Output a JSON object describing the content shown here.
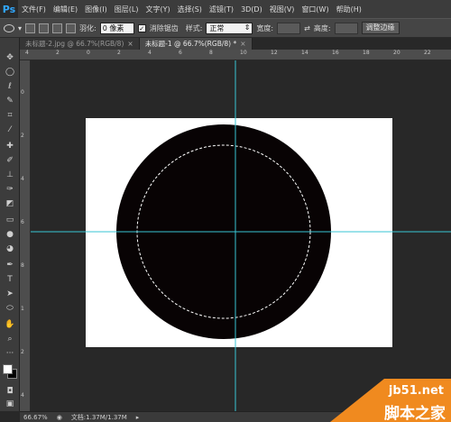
{
  "app": {
    "logo": "Ps"
  },
  "menu": [
    "文件(F)",
    "编辑(E)",
    "图像(I)",
    "图层(L)",
    "文字(Y)",
    "选择(S)",
    "滤镜(T)",
    "3D(D)",
    "视图(V)",
    "窗口(W)",
    "帮助(H)"
  ],
  "options": {
    "feather_label": "羽化:",
    "feather_value": "0 像素",
    "antialias_label": "消除锯齿",
    "style_label": "样式:",
    "style_value": "正常",
    "width_label": "宽度:",
    "height_label": "高度:",
    "refine_edge": "调整边缘"
  },
  "tabs": [
    {
      "label": "未标题-2.jpg @ 66.7%(RGB/8)",
      "active": false
    },
    {
      "label": "未标题-1 @ 66.7%(RGB/8) *",
      "active": true
    }
  ],
  "ruler": {
    "top": [
      "4",
      "2",
      "0",
      "2",
      "4",
      "6",
      "8",
      "10",
      "12",
      "14",
      "16",
      "18",
      "20",
      "22"
    ],
    "left": [
      "0",
      "2",
      "4",
      "6",
      "8",
      "1",
      "2",
      "4"
    ]
  },
  "status": {
    "zoom": "66.67%",
    "doc": "文档:1.37M/1.37M"
  },
  "watermark": {
    "url": "jb51.net",
    "cn": "脚本之家"
  },
  "colors": {
    "guide": "#39c6d4",
    "fill": "#080304",
    "foreground": "#ffffff",
    "background": "#000000",
    "watermark_orange": "#f08a1f"
  }
}
